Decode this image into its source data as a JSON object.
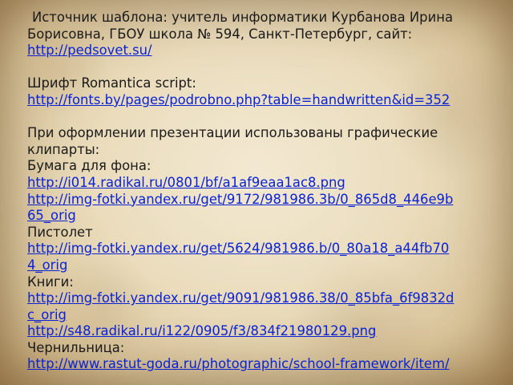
{
  "intro": {
    "line1": "Источник шаблона: учитель информатики Курбанова Ирина",
    "line2": "Борисовна, ГБОУ школа № 594, Санкт-Петербург, сайт:",
    "site_link": "http://pedsovet.su/"
  },
  "font": {
    "label": "Шрифт Romantica script:",
    "link": "http://fonts.by/pages/podrobno.php?table=handwritten&id=352"
  },
  "clipart": {
    "line1": "При оформлении презентации использованы графические",
    "line2": "клипарты:"
  },
  "paper": {
    "label": "Бумага для фона:",
    "link1": "http://i014.radikal.ru/0801/bf/a1af9eaa1ac8.png",
    "link2_part1": "http://img-fotki.yandex.ru/get/9172/981986.3b/0_865d8_446e9b",
    "link2_part2": "65_orig"
  },
  "pistol": {
    "label": "Пистолет",
    "link_part1": "http://img-fotki.yandex.ru/get/5624/981986.b/0_80a18_a44fb70",
    "link_part2": "4_orig"
  },
  "books": {
    "label": "Книги:",
    "link1_part1": "http://img-fotki.yandex.ru/get/9091/981986.38/0_85bfa_6f9832d",
    "link1_part2": "c_orig",
    "link2": "http://s48.radikal.ru/i122/0905/f3/834f21980129.png"
  },
  "inkwell": {
    "label": "Чернильница:",
    "link_part1": "http://www.rastut-goda.ru/photographic/school-framework/item/"
  },
  "colors": {
    "link": "#0a23d6",
    "text": "#1a1a1a",
    "paper": "#eadcbc"
  }
}
